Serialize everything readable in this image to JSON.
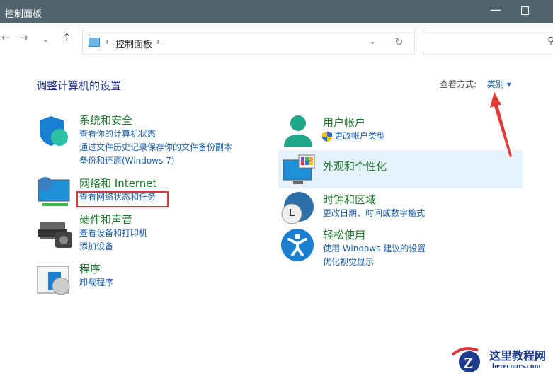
{
  "window": {
    "title": "控制面板"
  },
  "address": {
    "crumb": "控制面板",
    "sep": "›"
  },
  "nav": {
    "back": "←",
    "forward": "→",
    "recent": "⌄",
    "up": "↑"
  },
  "heading": "调整计算机的设置",
  "view_by": {
    "label": "查看方式:",
    "value": "类别 ▾"
  },
  "left": [
    {
      "title": "系统和安全",
      "links": [
        "查看你的计算机状态",
        "通过文件历史记录保存你的文件备份副本",
        "备份和还原(Windows 7)"
      ]
    },
    {
      "title": "网络和 Internet",
      "links": [
        "查看网络状态和任务"
      ]
    },
    {
      "title": "硬件和声音",
      "links": [
        "查看设备和打印机",
        "添加设备"
      ]
    },
    {
      "title": "程序",
      "links": [
        "卸载程序"
      ]
    }
  ],
  "right": [
    {
      "title": "用户帐户",
      "links": [
        "更改帐户类型"
      ]
    },
    {
      "title": "外观和个性化",
      "links": []
    },
    {
      "title": "时钟和区域",
      "links": [
        "更改日期、时间或数字格式"
      ]
    },
    {
      "title": "轻松使用",
      "links": [
        "使用 Windows 建议的设置",
        "优化视觉显示"
      ]
    }
  ],
  "watermark": {
    "name": "这里教程网",
    "url": "herecours.com"
  },
  "colors": {
    "titlebar": "#52656f",
    "title": "#1f7a2e",
    "link": "#1a5fb4",
    "highlight": "#e5f1fb",
    "annotation": "#d9363e"
  }
}
